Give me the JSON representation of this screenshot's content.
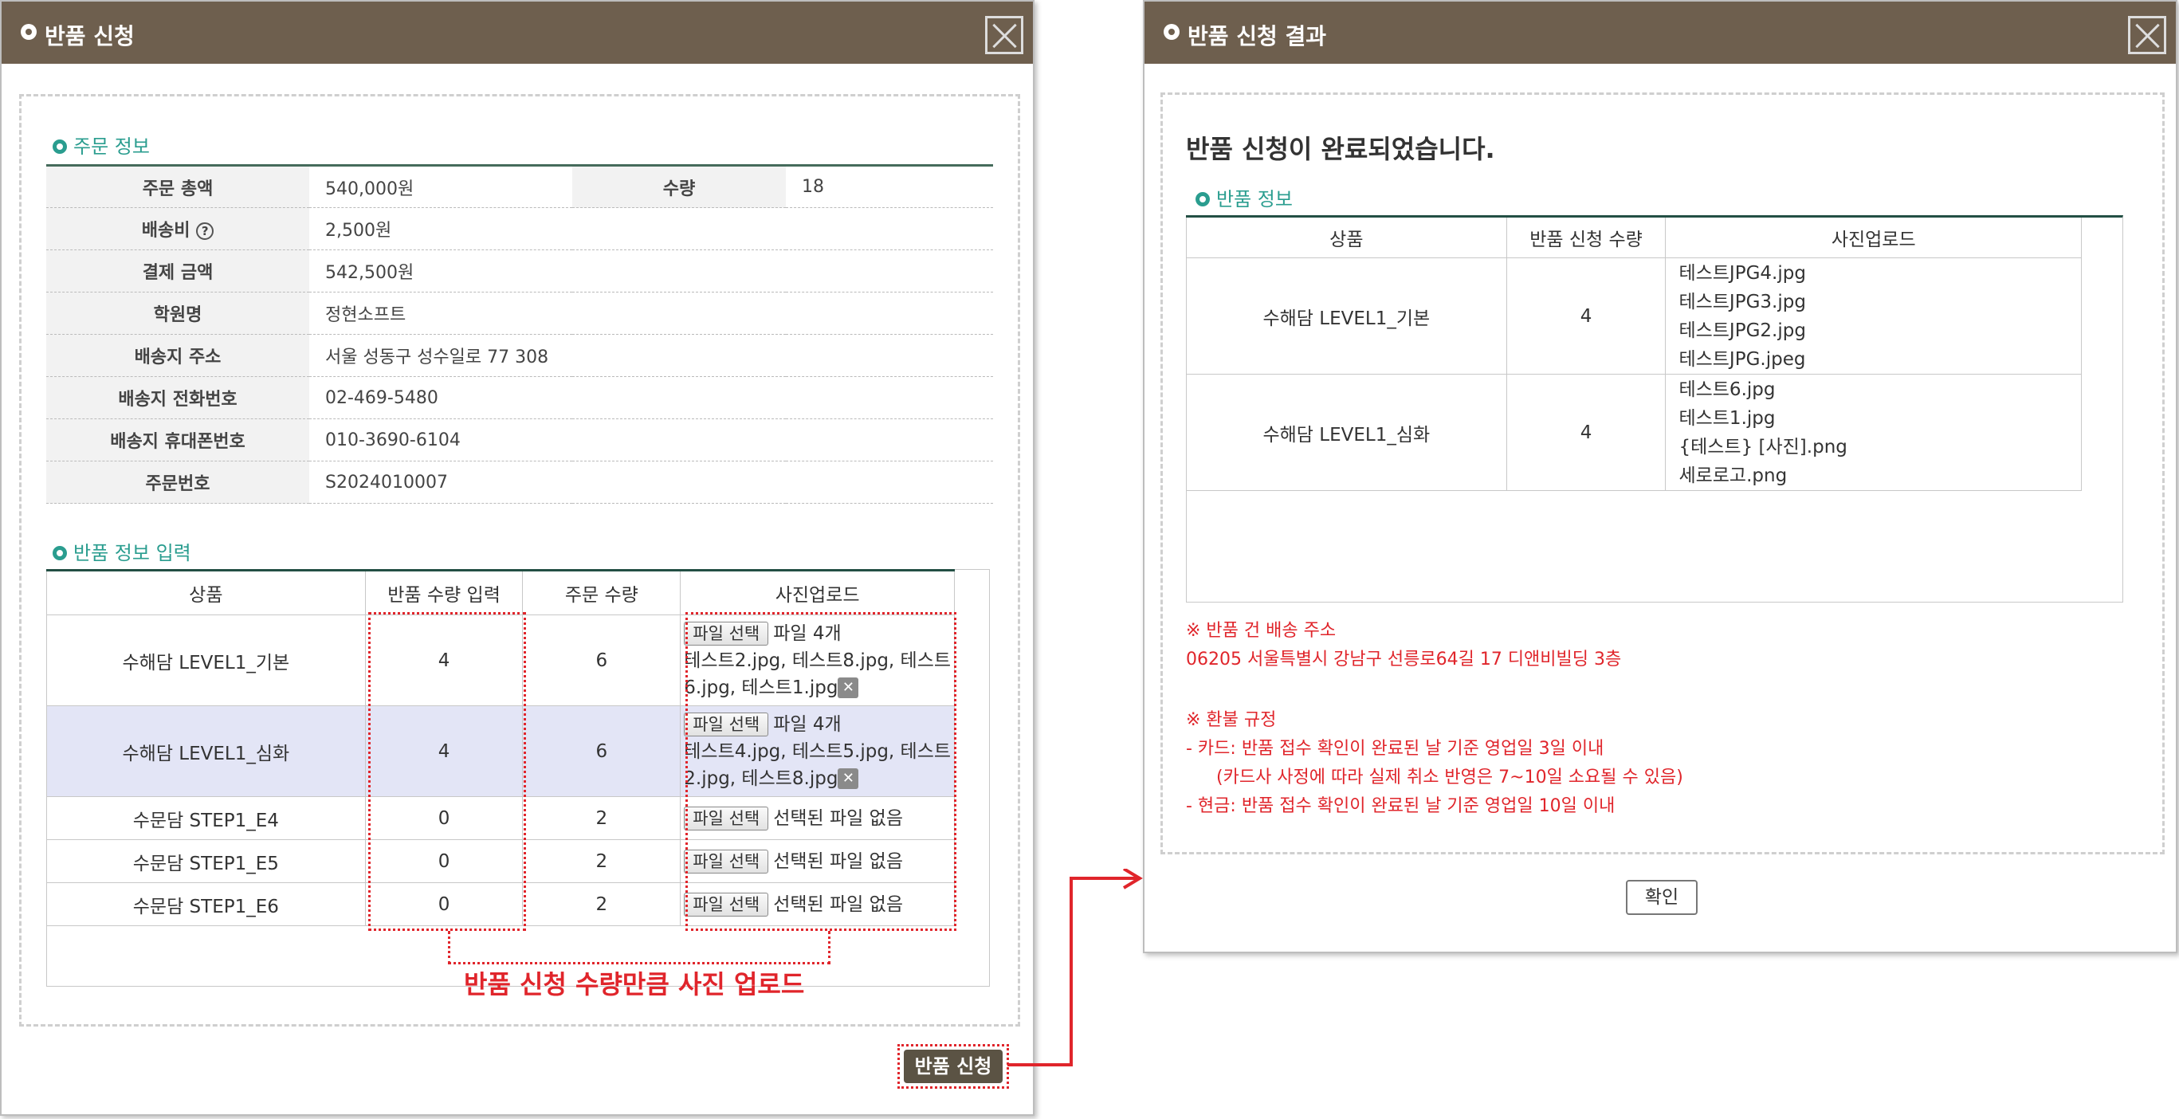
{
  "left_dialog": {
    "title": "반품 신청",
    "order_section_title": "주문 정보",
    "order_info": {
      "total_label": "주문 총액",
      "total_value": "540,000원",
      "qty_label": "수량",
      "qty_value": "18",
      "shipping_label": "배송비",
      "shipping_value": "2,500원",
      "paid_label": "결제 금액",
      "paid_value": "542,500원",
      "academy_label": "학원명",
      "academy_value": "정현소프트",
      "address_label": "배송지 주소",
      "address_value": "서울 성동구 성수일로 77 308",
      "phone_label": "배송지 전화번호",
      "phone_value": "02-469-5480",
      "mobile_label": "배송지 휴대폰번호",
      "mobile_value": "010-3690-6104",
      "order_no_label": "주문번호",
      "order_no_value": "S2024010007"
    },
    "return_section_title": "반품 정보 입력",
    "return_table": {
      "headers": [
        "상품",
        "반품 수량 입력",
        "주문 수량",
        "사진업로드"
      ],
      "file_button_label": "파일 선택",
      "rows": [
        {
          "product": "수해담 LEVEL1_기본",
          "return_qty": "4",
          "order_qty": "6",
          "file_status": "파일 4개",
          "files_text": "테스트2.jpg, 테스트8.jpg, 테스트6.jpg, 테스트1.jpg"
        },
        {
          "product": "수해담 LEVEL1_심화",
          "return_qty": "4",
          "order_qty": "6",
          "file_status": "파일 4개",
          "files_text": "테스트4.jpg, 테스트5.jpg, 테스트2.jpg, 테스트8.jpg"
        },
        {
          "product": "수문담 STEP1_E4",
          "return_qty": "0",
          "order_qty": "2",
          "file_status": "선택된 파일 없음"
        },
        {
          "product": "수문담 STEP1_E5",
          "return_qty": "0",
          "order_qty": "2",
          "file_status": "선택된 파일 없음"
        },
        {
          "product": "수문담 STEP1_E6",
          "return_qty": "0",
          "order_qty": "2",
          "file_status": "선택된 파일 없음"
        }
      ]
    },
    "annotation": "반품 신청 수량만큼 사진 업로드",
    "submit_label": "반품 신청"
  },
  "right_dialog": {
    "title": "반품 신청 결과",
    "heading": "반품 신청이 완료되었습니다.",
    "section_title": "반품 정보",
    "table": {
      "headers": [
        "상품",
        "반품 신청 수량",
        "사진업로드"
      ],
      "rows": [
        {
          "product": "수해담 LEVEL1_기본",
          "qty": "4",
          "files": [
            "테스트JPG4.jpg",
            "테스트JPG3.jpg",
            "테스트JPG2.jpg",
            "테스트JPG.jpeg"
          ]
        },
        {
          "product": "수해담 LEVEL1_심화",
          "qty": "4",
          "files": [
            "테스트6.jpg",
            "테스트1.jpg",
            "{테스트} [사진].png",
            "세로로고.png"
          ]
        }
      ]
    },
    "address_notice_title": "※ 반품 건 배송 주소",
    "address_notice": "06205 서울특별시 강남구 선릉로64길 17 디앤비빌딩 3층",
    "refund_title": "※ 환불 규정",
    "refund_card": "- 카드: 반품 접수 확인이 완료된 날 기준 영업일 3일 이내",
    "refund_card_sub": "(카드사 사정에 따라 실제 취소 반영은 7~10일 소요될 수 있음)",
    "refund_cash": "- 현금: 반품 접수 확인이 완료된 날 기준 영업일 10일 이내",
    "confirm_label": "확인"
  },
  "colors": {
    "header": "#6e5f4e",
    "accent": "#2a9d8f",
    "annotation": "#e0252b",
    "selected_row": "#e3e5f6"
  }
}
